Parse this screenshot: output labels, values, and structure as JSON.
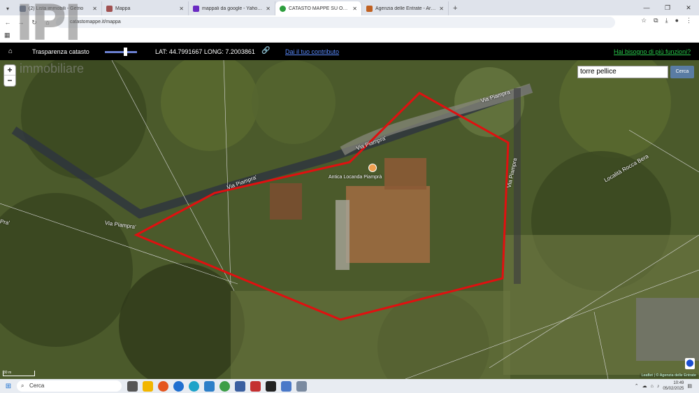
{
  "browser": {
    "tabs": [
      {
        "title": "(2) Lista immobili - Getrio",
        "active": false,
        "color": "#5f6f8f"
      },
      {
        "title": "Mappa",
        "active": false,
        "color": "#a05050"
      },
      {
        "title": "mappali da google - Yahoo Ital",
        "active": false,
        "color": "#6a2ac2"
      },
      {
        "title": "CATASTO MAPPE SU ORTOFOTO",
        "active": true,
        "color": "#2e9e3e"
      },
      {
        "title": "Agenzia delle Entrate - Area ris",
        "active": false,
        "color": "#c06020"
      }
    ],
    "url": "catastomappe.it/mappa",
    "new_tab": "+"
  },
  "site": {
    "transparency_label": "Trasparenza catasto",
    "transparency_value": 0.6,
    "coords": "LAT: 44.7991667 LONG: 7.2003861",
    "contribute": "Dai il tuo contributo",
    "help": "Hai bisogno di più funzioni?"
  },
  "logo": {
    "big": "IPI",
    "small": "immobiliare"
  },
  "map": {
    "zoom_in": "+",
    "zoom_out": "−",
    "search_value": "torre pellice",
    "search_button": "Cerca",
    "poi_label": "Antica Locanda Piamprà",
    "roads": [
      {
        "label": "Via Piampra'"
      },
      {
        "label": "Via Piampra'"
      },
      {
        "label": "Via Piampra'"
      },
      {
        "label": "Via Piampra"
      },
      {
        "label": "Via Piampra"
      },
      {
        "label": "Pra'"
      }
    ],
    "locality": "Località Rocca Bera",
    "attribution": "Leaflet | © Agenzia delle Entrate",
    "scale": "30 m",
    "boundary_color": "#e01010"
  },
  "taskbar": {
    "search_label": "Cerca",
    "time": "10:49",
    "date": "05/02/2025"
  }
}
